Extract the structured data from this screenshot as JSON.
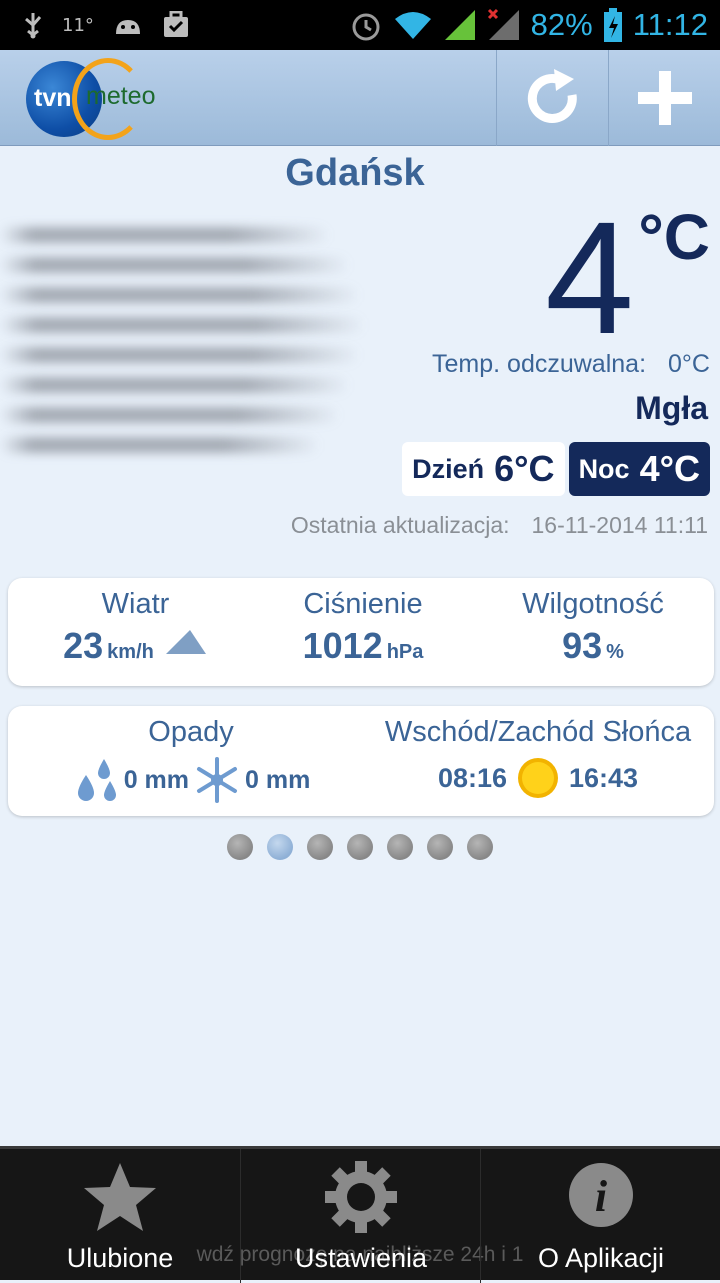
{
  "status_bar": {
    "notification_temp": "11°",
    "battery_percent": "82%",
    "time": "11:12",
    "icons": [
      "usb-icon",
      "android-icon",
      "briefcase-icon",
      "alarm-icon",
      "wifi-icon",
      "signal-icon",
      "signal-x-icon",
      "battery-charging-icon"
    ]
  },
  "header": {
    "logo_tvn": "tvn",
    "logo_meteo": "meteo",
    "refresh_icon": "refresh-icon",
    "add_icon": "plus-icon"
  },
  "weather": {
    "city": "Gdańsk",
    "temperature": "4",
    "unit": "°C",
    "feels_like_label": "Temp. odczuwalna:",
    "feels_like_value": "0°C",
    "condition": "Mgła",
    "day_label": "Dzień",
    "day_value": "6°C",
    "night_label": "Noc",
    "night_value": "4°C",
    "updated_label": "Ostatnia aktualizacja:",
    "updated_value": "16-11-2014 11:11"
  },
  "details": {
    "wind_title": "Wiatr",
    "wind_value": "23",
    "wind_unit": "km/h",
    "pressure_title": "Ciśnienie",
    "pressure_value": "1012",
    "pressure_unit": "hPa",
    "humidity_title": "Wilgotność",
    "humidity_value": "93",
    "humidity_unit": "%"
  },
  "extras": {
    "precip_title": "Opady",
    "rain_value": "0 mm",
    "snow_value": "0 mm",
    "sun_title": "Wschód/Zachód Słońca",
    "sunrise": "08:16",
    "sunset": "16:43"
  },
  "pager": {
    "count": 7,
    "active_index": 1
  },
  "bottom_nav": {
    "hint": "wdź prognozę na najbliższe 24h i 1",
    "favorites": "Ulubione",
    "settings": "Ustawienia",
    "about": "O Aplikacji"
  },
  "colors": {
    "accent": "#3b6496",
    "dark": "#14295a",
    "status_blue": "#32b5e5"
  }
}
